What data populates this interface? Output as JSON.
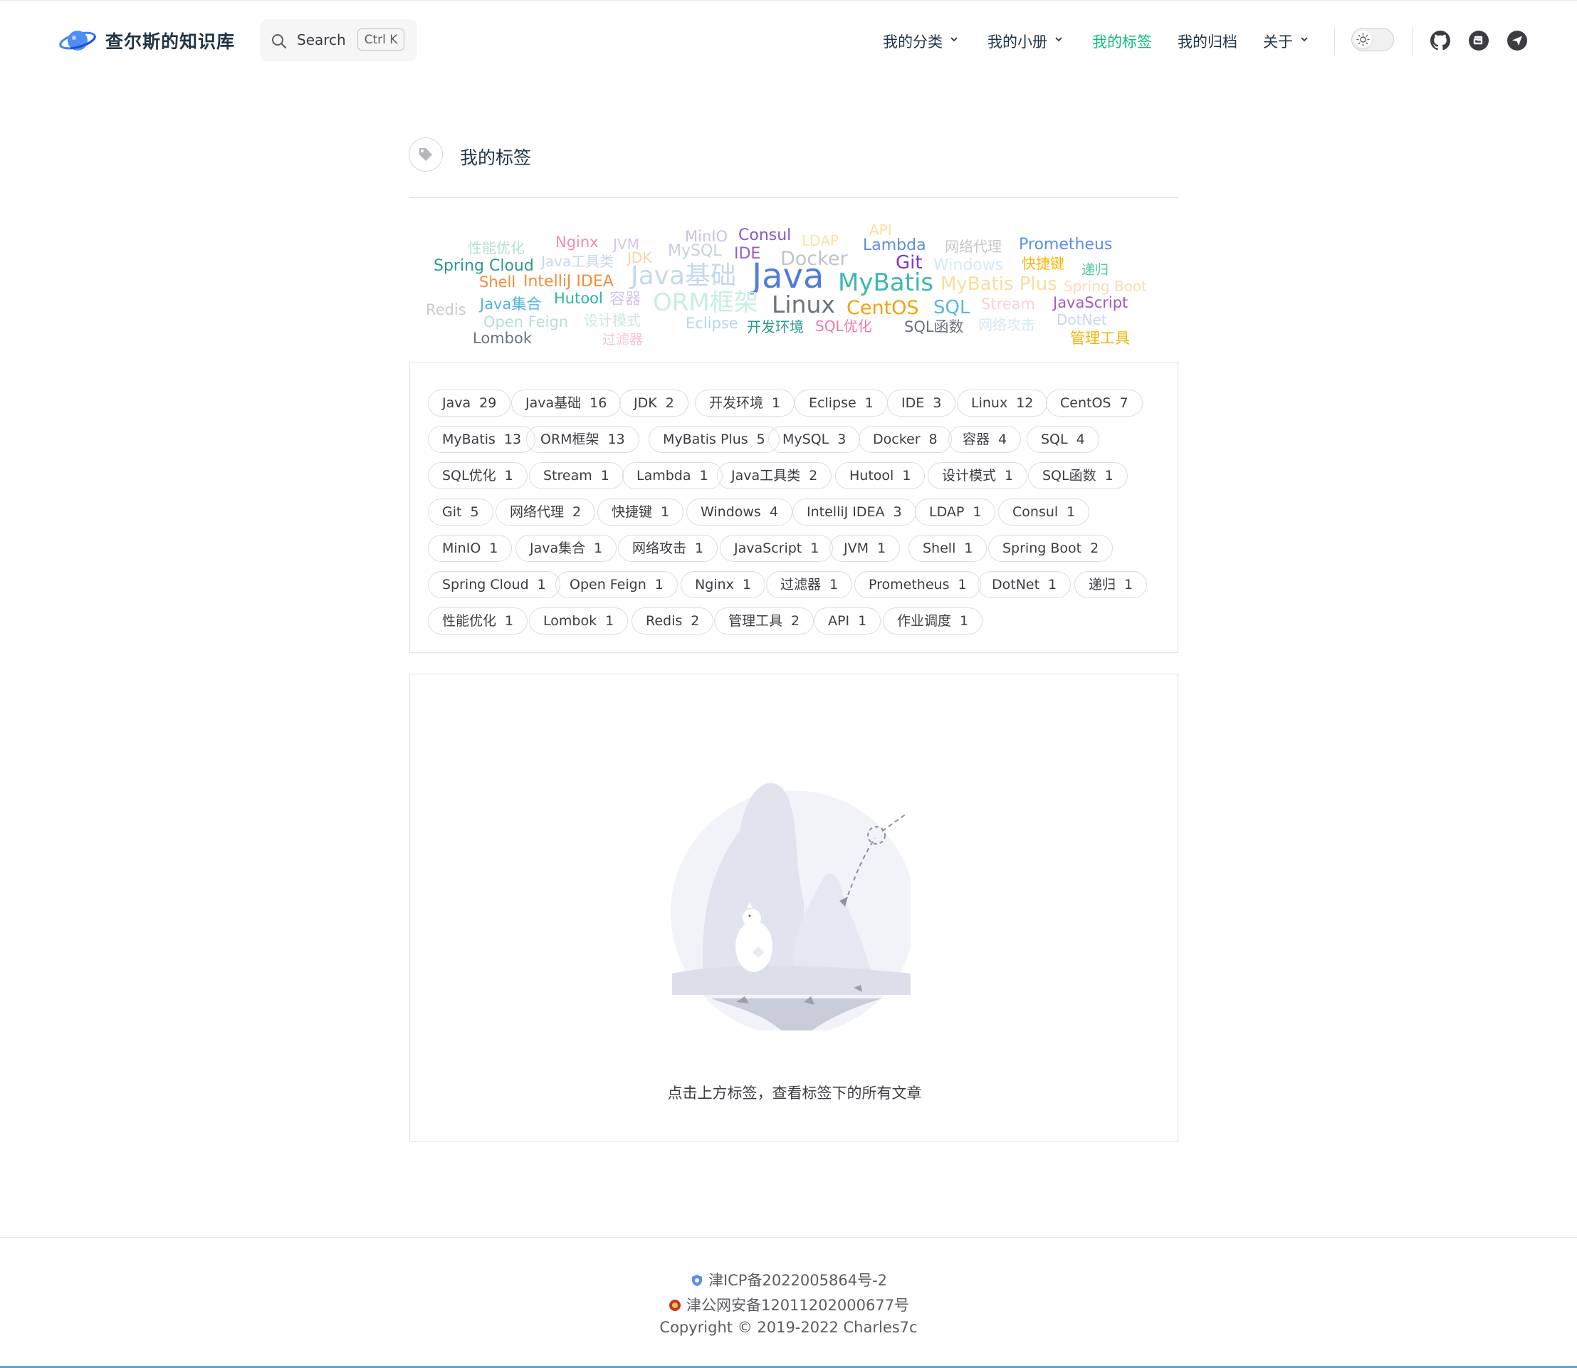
{
  "header": {
    "site_title": "查尔斯的知识库",
    "search": {
      "label": "Search",
      "shortcut": "Ctrl K"
    },
    "nav": [
      {
        "label": "我的分类",
        "has_dropdown": true
      },
      {
        "label": "我的小册",
        "has_dropdown": true
      },
      {
        "label": "我的标签",
        "active": true
      },
      {
        "label": "我的归档"
      },
      {
        "label": "关于",
        "has_dropdown": true
      }
    ],
    "icons": [
      "logo-planet-icon",
      "search-icon",
      "chevron-down-icon",
      "sun-icon",
      "github-icon",
      "gitee-icon",
      "send-icon"
    ],
    "accent_color": "#10b981"
  },
  "page": {
    "title": "我的标签",
    "title_icon": "tag-icon"
  },
  "word_cloud": [
    {
      "text": "性能优化",
      "color": "#b4e0cf"
    },
    {
      "text": "Nginx",
      "color": "#f08cb0"
    },
    {
      "text": "JVM",
      "color": "#d8c2ea"
    },
    {
      "text": "MinIO",
      "color": "#cdbfe6"
    },
    {
      "text": "Consul",
      "color": "#8e55c9"
    },
    {
      "text": "LDAP",
      "color": "#fbe2a6"
    },
    {
      "text": "API",
      "color": "#fbe0a0"
    },
    {
      "text": "Lambda",
      "color": "#5d8ddc"
    },
    {
      "text": "网络代理",
      "color": "#c6c8cc"
    },
    {
      "text": "Prometheus",
      "color": "#5b8def"
    },
    {
      "text": "Spring Cloud",
      "color": "#2f9a8a"
    },
    {
      "text": "Java工具类",
      "color": "#c6d8ef"
    },
    {
      "text": "JDK",
      "color": "#f7d4a8"
    },
    {
      "text": "MySQL",
      "color": "#c7cfe0"
    },
    {
      "text": "IDE",
      "color": "#9b5cc3"
    },
    {
      "text": "Docker",
      "color": "#c0c4cc"
    },
    {
      "text": "Git",
      "color": "#7c3ac0"
    },
    {
      "text": "Windows",
      "color": "#d7e8f7"
    },
    {
      "text": "快捷键",
      "color": "#f2b70f"
    },
    {
      "text": "递归",
      "color": "#4cc9a4"
    },
    {
      "text": "Shell",
      "color": "#f58b3c"
    },
    {
      "text": "IntelliJ IDEA",
      "color": "#f58b3c"
    },
    {
      "text": "Java基础",
      "color": "#c5d8f0"
    },
    {
      "text": "Java",
      "color": "#4f7ddb"
    },
    {
      "text": "MyBatis",
      "color": "#3fb8ae"
    },
    {
      "text": "MyBatis Plus",
      "color": "#f9dd9e"
    },
    {
      "text": "Spring Boot",
      "color": "#fbdcb5"
    },
    {
      "text": "Redis",
      "color": "#c8cbd1"
    },
    {
      "text": "Java集合",
      "color": "#50b4e0"
    },
    {
      "text": "Hutool",
      "color": "#2bb5a5"
    },
    {
      "text": "容器",
      "color": "#d7c5ea"
    },
    {
      "text": "ORM框架",
      "color": "#c9ece4"
    },
    {
      "text": "Linux",
      "color": "#6b7280"
    },
    {
      "text": "CentOS",
      "color": "#f0a20e"
    },
    {
      "text": "SQL",
      "color": "#58b8e0"
    },
    {
      "text": "Stream",
      "color": "#f9d0dd"
    },
    {
      "text": "JavaScript",
      "color": "#9d5ac9"
    },
    {
      "text": "Open Feign",
      "color": "#b8ddd8"
    },
    {
      "text": "设计模式",
      "color": "#cbe9df"
    },
    {
      "text": "Eclipse",
      "color": "#b6d5ef"
    },
    {
      "text": "开发环境",
      "color": "#2b9b8d"
    },
    {
      "text": "SQL优化",
      "color": "#ee7ab0"
    },
    {
      "text": "SQL函数",
      "color": "#6b7280"
    },
    {
      "text": "网络攻击",
      "color": "#d5e8f7"
    },
    {
      "text": "DotNet",
      "color": "#cad4f3"
    },
    {
      "text": "Lombok",
      "color": "#6b7280"
    },
    {
      "text": "过滤器",
      "color": "#f9c5d6"
    },
    {
      "text": "管理工具",
      "color": "#f2b40c"
    }
  ],
  "tags": [
    {
      "name": "Java",
      "count": "29"
    },
    {
      "name": "Java基础",
      "count": "16"
    },
    {
      "name": "JDK",
      "count": "2"
    },
    {
      "name": "开发环境",
      "count": "1"
    },
    {
      "name": "Eclipse",
      "count": "1"
    },
    {
      "name": "IDE",
      "count": "3"
    },
    {
      "name": "Linux",
      "count": "12"
    },
    {
      "name": "CentOS",
      "count": "7"
    },
    {
      "name": "MyBatis",
      "count": "13"
    },
    {
      "name": "ORM框架",
      "count": "13"
    },
    {
      "name": "MyBatis Plus",
      "count": "5"
    },
    {
      "name": "MySQL",
      "count": "3"
    },
    {
      "name": "Docker",
      "count": "8"
    },
    {
      "name": "容器",
      "count": "4"
    },
    {
      "name": "SQL",
      "count": "4"
    },
    {
      "name": "SQL优化",
      "count": "1"
    },
    {
      "name": "Stream",
      "count": "1"
    },
    {
      "name": "Lambda",
      "count": "1"
    },
    {
      "name": "Java工具类",
      "count": "2"
    },
    {
      "name": "Hutool",
      "count": "1"
    },
    {
      "name": "设计模式",
      "count": "1"
    },
    {
      "name": "SQL函数",
      "count": "1"
    },
    {
      "name": "Git",
      "count": "5"
    },
    {
      "name": "网络代理",
      "count": "2"
    },
    {
      "name": "快捷键",
      "count": "1"
    },
    {
      "name": "Windows",
      "count": "4"
    },
    {
      "name": "IntelliJ IDEA",
      "count": "3"
    },
    {
      "name": "LDAP",
      "count": "1"
    },
    {
      "name": "Consul",
      "count": "1"
    },
    {
      "name": "MinIO",
      "count": "1"
    },
    {
      "name": "Java集合",
      "count": "1"
    },
    {
      "name": "网络攻击",
      "count": "1"
    },
    {
      "name": "JavaScript",
      "count": "1"
    },
    {
      "name": "JVM",
      "count": "1"
    },
    {
      "name": "Shell",
      "count": "1"
    },
    {
      "name": "Spring Boot",
      "count": "2"
    },
    {
      "name": "Spring Cloud",
      "count": "1"
    },
    {
      "name": "Open Feign",
      "count": "1"
    },
    {
      "name": "Nginx",
      "count": "1"
    },
    {
      "name": "过滤器",
      "count": "1"
    },
    {
      "name": "Prometheus",
      "count": "1"
    },
    {
      "name": "DotNet",
      "count": "1"
    },
    {
      "name": "递归",
      "count": "1"
    },
    {
      "name": "性能优化",
      "count": "1"
    },
    {
      "name": "Lombok",
      "count": "1"
    },
    {
      "name": "Redis",
      "count": "2"
    },
    {
      "name": "管理工具",
      "count": "2"
    },
    {
      "name": "API",
      "count": "1"
    },
    {
      "name": "作业调度",
      "count": "1"
    }
  ],
  "empty_state": {
    "illustration": "polar-bear-empty-illustration",
    "message": "点击上方标签，查看标签下的所有文章"
  },
  "footer": {
    "icp": "津ICP备2022005864号-2",
    "police": "津公网安备12011202000677号",
    "copyright": "Copyright © 2019-2022 Charles7c"
  }
}
